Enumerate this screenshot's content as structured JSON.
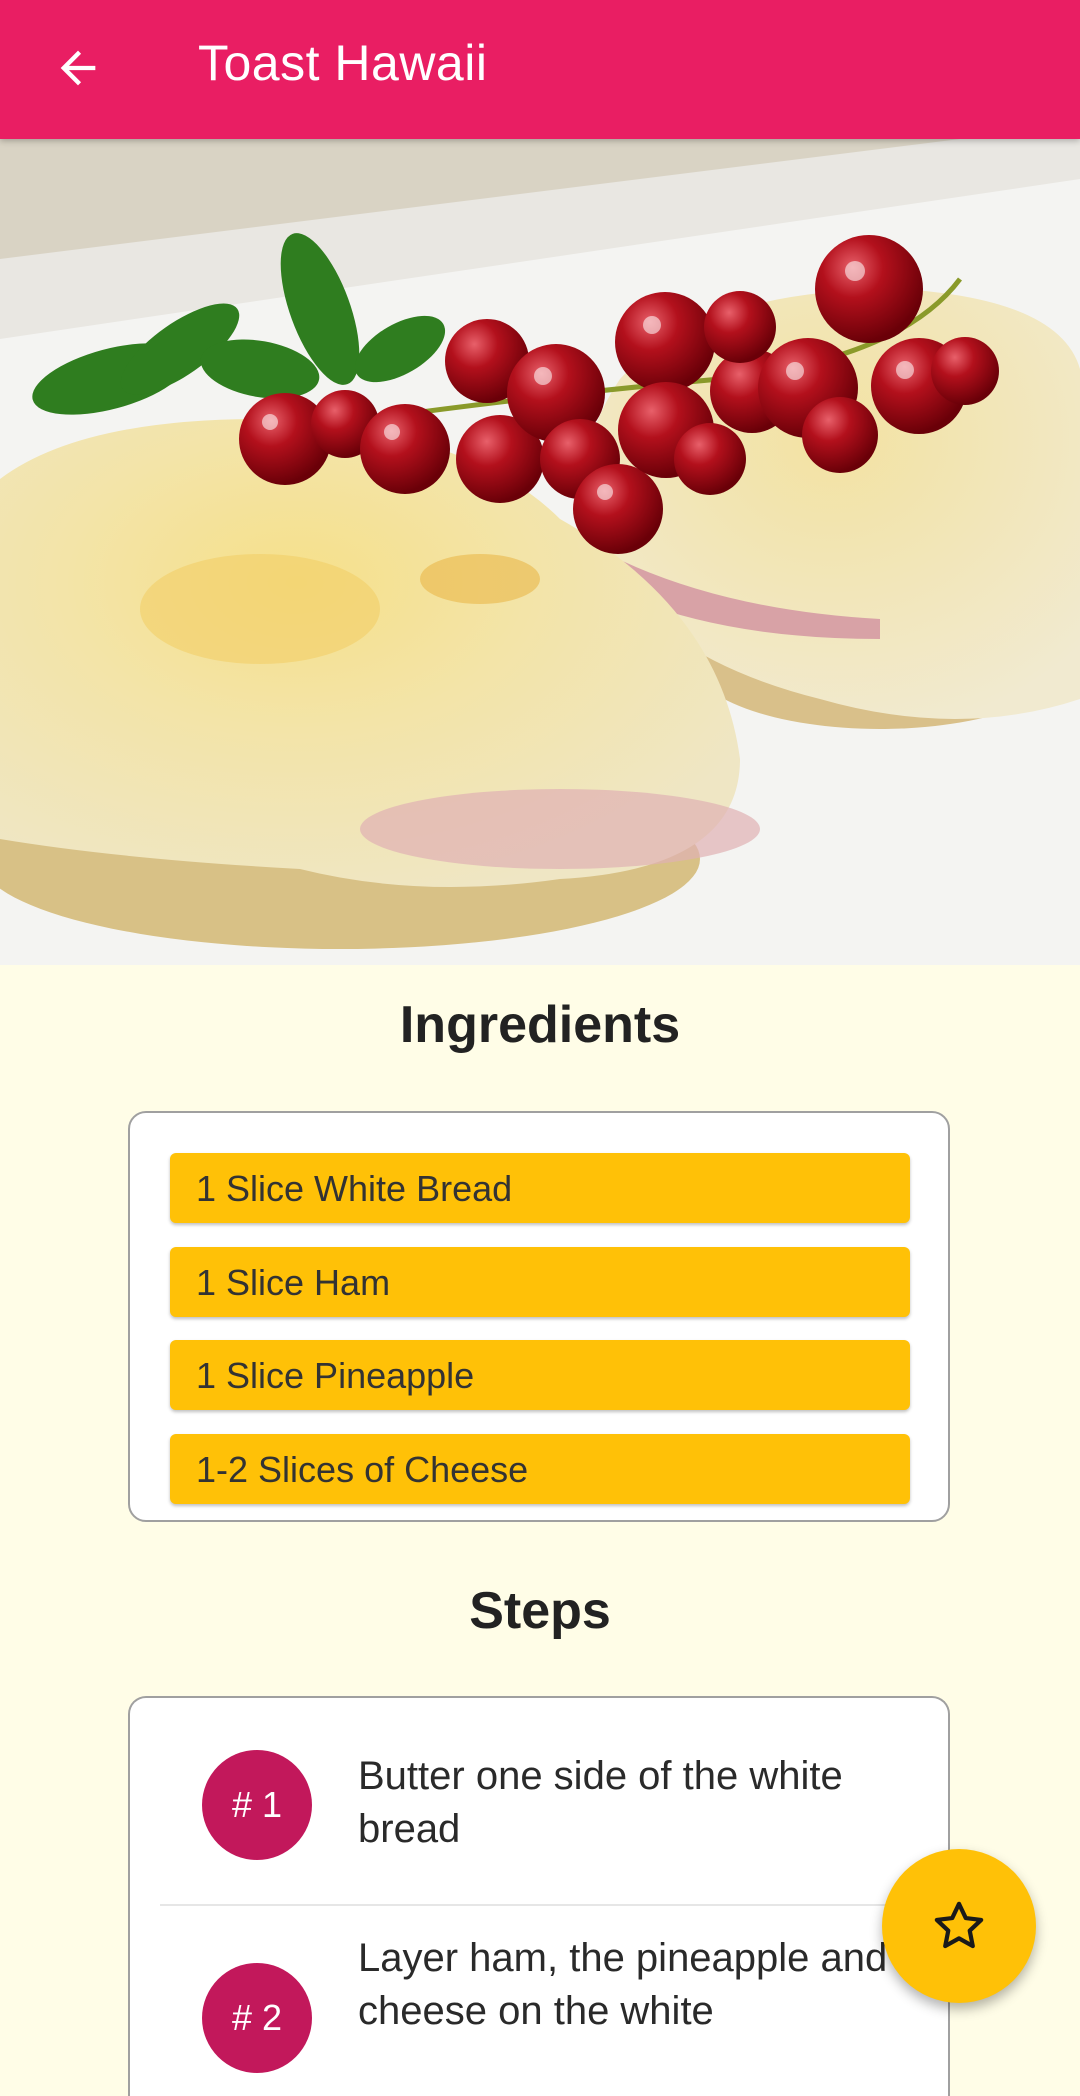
{
  "app_bar": {
    "title": "Toast Hawaii",
    "color": "#e91e63"
  },
  "hero_image": {
    "description": "toast-hawaii-photo"
  },
  "ingredients": {
    "title": "Ingredients",
    "items": [
      "1 Slice White Bread",
      "1 Slice Ham",
      "1 Slice Pineapple",
      "1-2 Slices of Cheese"
    ]
  },
  "steps": {
    "title": "Steps",
    "items": [
      {
        "badge": "# 1",
        "text": "Butter one side of the white bread"
      },
      {
        "badge": "# 2",
        "text": "Layer ham, the pineapple and cheese on the white"
      }
    ]
  },
  "fab": {
    "icon": "star-outline-icon"
  },
  "colors": {
    "accent": "#ffc107",
    "badge": "#c2185b",
    "background": "#fffde7"
  }
}
